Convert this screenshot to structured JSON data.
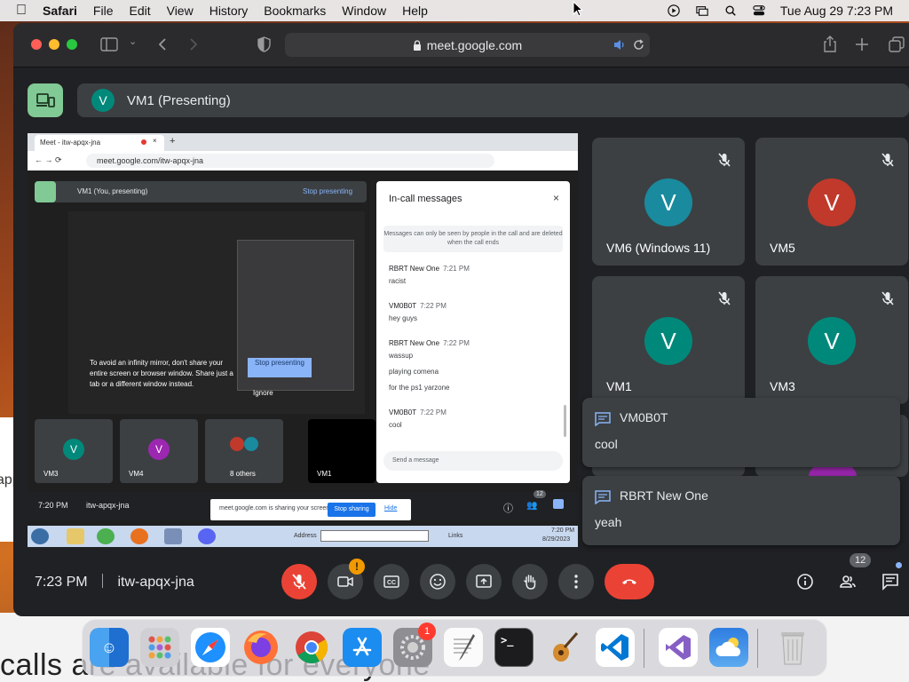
{
  "menubar": {
    "app_name": "Safari",
    "menus": [
      "File",
      "Edit",
      "View",
      "History",
      "Bookmarks",
      "Window",
      "Help"
    ],
    "clock": "Tue Aug 29  7:23 PM"
  },
  "browser": {
    "url": "meet.google.com"
  },
  "presenting": {
    "avatar_letter": "V",
    "label": "VM1 (Presenting)"
  },
  "shared_screen": {
    "tab_title": "Meet - itw-apqx-jna",
    "url": "meet.google.com/itw-apqx-jna",
    "present_label": "VM1 (You, presenting)",
    "stop_presenting_link": "Stop presenting",
    "infinity_warning": "To avoid an infinity mirror, don't share your entire screen or browser window. Share just a tab or a different window instead.",
    "stop_presenting_button": "Stop presenting",
    "ignore": "Ignore",
    "tiles": [
      {
        "letter": "V",
        "name": "VM3",
        "color": "#00897b"
      },
      {
        "letter": "V",
        "name": "VM4",
        "color": "#9c27b0"
      },
      {
        "letter": "",
        "name": "8 others",
        "color": "#3c4043"
      },
      {
        "letter": "",
        "name": "VM1",
        "color": "#000000"
      }
    ],
    "panel_title": "In-call messages",
    "panel_note": "Messages can only be seen by people in the call and are deleted when the call ends",
    "messages": [
      {
        "sender": "RBRT New One",
        "time": "7:21 PM",
        "lines": [
          "racist"
        ]
      },
      {
        "sender": "VM0B0T",
        "time": "7:22 PM",
        "lines": [
          "hey guys"
        ]
      },
      {
        "sender": "RBRT New One",
        "time": "7:22 PM",
        "lines": [
          "wassup",
          "playing comena",
          "for the ps1 yarzone"
        ]
      },
      {
        "sender": "VM0B0T",
        "time": "7:22 PM",
        "lines": [
          "cool"
        ]
      }
    ],
    "send_placeholder": "Send a message",
    "bottom_time": "7:20 PM",
    "bottom_meeting": "itw-apqx-jna",
    "share_banner_text": "meet.google.com is sharing your screen.",
    "share_stop": "Stop sharing",
    "share_hide": "Hide",
    "people_count": "12",
    "taskbar_address_label": "Address",
    "taskbar_links": "Links",
    "taskbar_time": "7:20 PM",
    "taskbar_date": "8/29/2023"
  },
  "participants": [
    {
      "letter": "V",
      "name": "VM6 (Windows 11)",
      "color": "#1a8a9e"
    },
    {
      "letter": "V",
      "name": "VM5",
      "color": "#c0392b"
    },
    {
      "letter": "V",
      "name": "VM1",
      "color": "#00897b"
    },
    {
      "letter": "V",
      "name": "VM3",
      "color": "#00897b"
    }
  ],
  "toasts": [
    {
      "sender": "VM0B0T",
      "message": "cool"
    },
    {
      "sender": "RBRT New One",
      "message": "yeah"
    }
  ],
  "controls": {
    "time": "7:23 PM",
    "meeting_code": "itw-apqx-jna",
    "people_count": "12"
  },
  "dock": {
    "settings_badge": "1",
    "apps": [
      "finder-icon",
      "launchpad-icon",
      "safari-icon",
      "firefox-icon",
      "chrome-icon",
      "app-store-icon",
      "system-settings-icon",
      "textedit-icon",
      "terminal-icon",
      "garageband-icon",
      "vscode-icon",
      "visual-studio-icon",
      "weather-icon",
      "trash-icon"
    ]
  },
  "background": {
    "left_fragment": "app",
    "bottom_fragment": "calls are available for everyone"
  },
  "colors": {
    "meet_bg": "#202124",
    "tile_bg": "#3c4043",
    "end_call_red": "#ea4335",
    "present_green": "#81c995"
  }
}
